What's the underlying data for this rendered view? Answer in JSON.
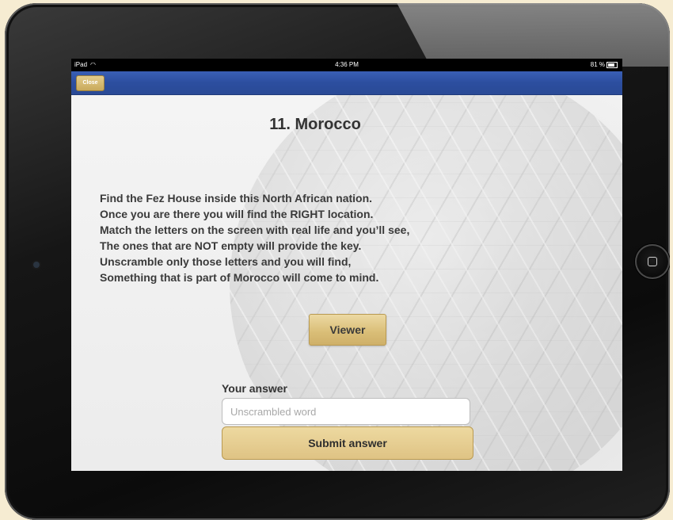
{
  "status_bar": {
    "carrier": "iPad",
    "wifi_icon": "wifi-icon",
    "time": "4:36 PM",
    "battery": "81 %",
    "battery_icon": "battery-icon"
  },
  "nav": {
    "close_label": "Close"
  },
  "main": {
    "title": "11. Morocco",
    "riddle_lines": [
      "Find the Fez House inside this North African nation.",
      "Once you are there you will find the RIGHT location.",
      "Match the letters on the screen with real life and you’ll see,",
      "The ones that are NOT empty will provide the key.",
      "Unscramble only those letters and you will find,",
      "Something that is part of Morocco will come to mind."
    ],
    "viewer_label": "Viewer",
    "answer_label": "Your answer",
    "answer_placeholder": "Unscrambled word",
    "answer_value": "",
    "submit_label": "Submit answer"
  },
  "colors": {
    "nav_bar": "#2c4e9f",
    "gold_button": "#dfc384",
    "device_frame": "#111111",
    "background": "#f6ecd2"
  }
}
